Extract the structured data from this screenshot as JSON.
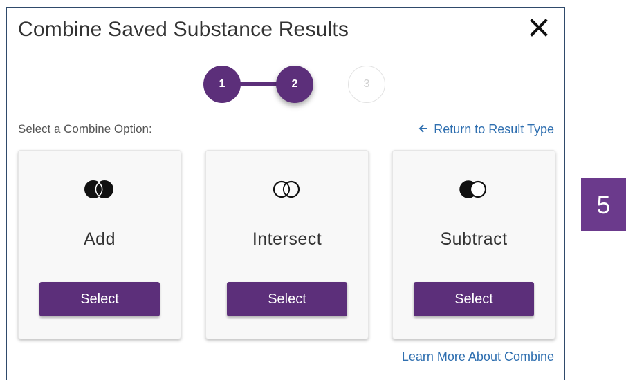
{
  "dialog": {
    "title": "Combine Saved Substance Results",
    "close_icon": "close-icon"
  },
  "stepper": {
    "steps": [
      {
        "label": "1",
        "state": "complete"
      },
      {
        "label": "2",
        "state": "active"
      },
      {
        "label": "3",
        "state": "inactive"
      }
    ]
  },
  "options": {
    "prompt": "Select a Combine Option:",
    "return_link": "Return to Result Type",
    "return_icon": "arrow-left-icon",
    "cards": [
      {
        "name": "Add",
        "icon": "venn-add-icon",
        "button": "Select"
      },
      {
        "name": "Intersect",
        "icon": "venn-intersect-icon",
        "button": "Select"
      },
      {
        "name": "Subtract",
        "icon": "venn-subtract-icon",
        "button": "Select"
      }
    ],
    "learn_more": "Learn More About Combine"
  },
  "badge": {
    "label": "5"
  },
  "colors": {
    "brand_purple": "#5c2f7a",
    "link_blue": "#2f6fb0",
    "dialog_border": "#2f4a6b"
  }
}
